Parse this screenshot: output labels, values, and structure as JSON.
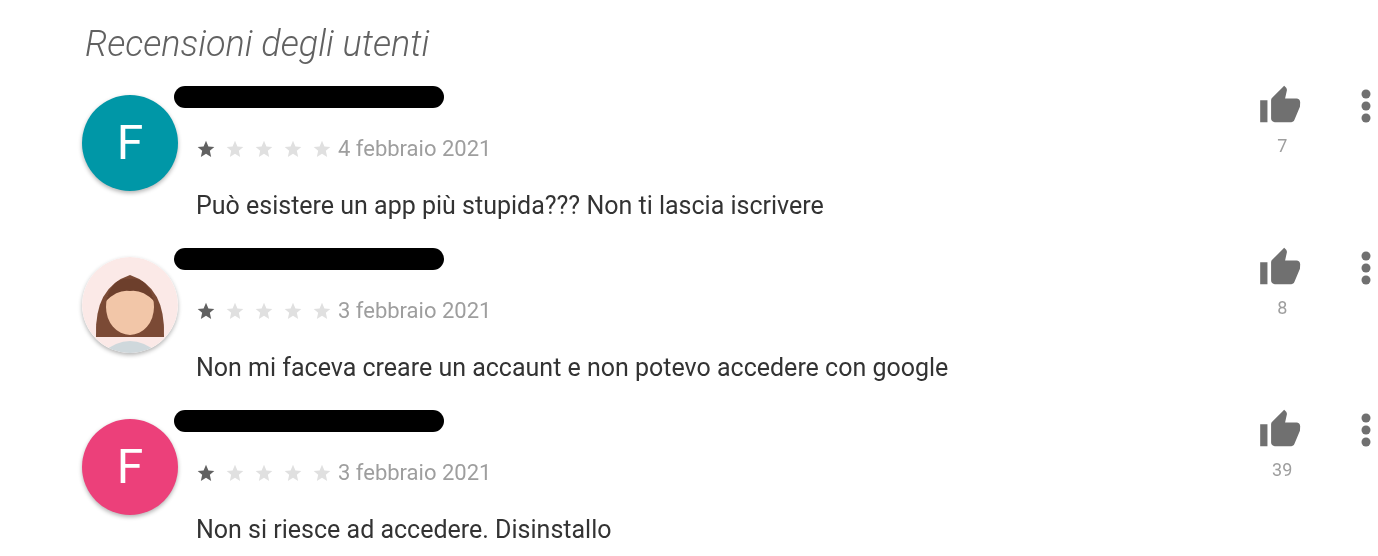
{
  "title": "Recensioni degli utenti",
  "reviews": [
    {
      "avatar": {
        "kind": "letter",
        "letter": "F",
        "color": "#0097a7"
      },
      "redacted": true,
      "stars": 1,
      "date": "4 febbraio 2021",
      "text": "Può esistere un app più stupida??? Non ti lascia iscrivere",
      "likes": "7"
    },
    {
      "redacted": true,
      "stars": 1,
      "date": "3 febbraio 2021",
      "text": "Non mi faceva creare un accaunt e non potevo accedere con google",
      "likes": "8"
    },
    {
      "avatar": {
        "kind": "letter",
        "letter": "F",
        "color": "#ec407a"
      },
      "redacted": true,
      "stars": 1,
      "date": "3 febbraio 2021",
      "text": "Non si riesce ad accedere. Disinstallo",
      "likes": "39"
    }
  ]
}
